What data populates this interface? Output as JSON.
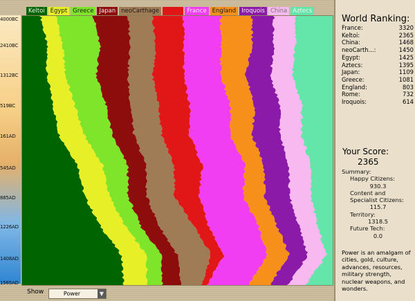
{
  "legend": [
    {
      "label": "Keltoi",
      "color": "#006400",
      "text": "#f2f2f2"
    },
    {
      "label": "Egypt",
      "color": "#e7ef26",
      "text": "#1b1b1b"
    },
    {
      "label": "Greece",
      "color": "#7ee52a",
      "text": "#1b1b1b"
    },
    {
      "label": "Japan",
      "color": "#8d0c0c",
      "text": "#eeeeee"
    },
    {
      "label": "neoCarthage",
      "color": "#a07c56",
      "text": "#1b1b1b"
    },
    {
      "label": "Rome",
      "color": "#e11717",
      "text": "#e11717"
    },
    {
      "label": "France",
      "color": "#f23ef2",
      "text": "#f2f2f2"
    },
    {
      "label": "England",
      "color": "#f7901b",
      "text": "#1b1b1b"
    },
    {
      "label": "Iroquois",
      "color": "#8b1aa8",
      "text": "#f2f2f2"
    },
    {
      "label": "China",
      "color": "#f8b8f0",
      "text": "#777777"
    },
    {
      "label": "Aztecs",
      "color": "#64e6aa",
      "text": "#f2f2f2"
    }
  ],
  "year_ticks": [
    "4000BC",
    "2410BC",
    "1312BC",
    "519BC",
    "161AD",
    "545AD",
    "885AD",
    "1226AD",
    "1408AD",
    "1565AD"
  ],
  "chart_data": {
    "type": "area",
    "x": [
      "4000BC",
      "2410BC",
      "1312BC",
      "519BC",
      "161AD",
      "545AD",
      "885AD",
      "1226AD",
      "1408AD",
      "1565AD"
    ],
    "stacked": true,
    "orientation": "vertical-time",
    "series_order": [
      "Keltoi",
      "Egypt",
      "Greece",
      "Japan",
      "neoCarthage",
      "Rome",
      "France",
      "England",
      "Iroquois",
      "China",
      "Aztecs"
    ],
    "series": [
      {
        "name": "Keltoi",
        "color": "#006400",
        "values": [
          6,
          8,
          8,
          10,
          12,
          18,
          20,
          25,
          32,
          34
        ]
      },
      {
        "name": "Egypt",
        "color": "#e7ef26",
        "values": [
          5,
          5,
          6,
          7,
          8,
          8,
          8,
          8,
          8,
          8
        ]
      },
      {
        "name": "Greece",
        "color": "#7ee52a",
        "values": [
          12,
          12,
          10,
          10,
          9,
          8,
          6,
          5,
          5,
          5
        ]
      },
      {
        "name": "Japan",
        "color": "#8d0c0c",
        "values": [
          11,
          10,
          10,
          8,
          7,
          6,
          6,
          6,
          5,
          6
        ]
      },
      {
        "name": "neoCarthage",
        "color": "#a07c56",
        "values": [
          8,
          8,
          8,
          9,
          9,
          9,
          9,
          11,
          11,
          7
        ]
      },
      {
        "name": "Rome",
        "color": "#e11717",
        "values": [
          10,
          9,
          10,
          10,
          9,
          9,
          8,
          5,
          4,
          2
        ]
      },
      {
        "name": "France",
        "color": "#f23ef2",
        "values": [
          12,
          12,
          12,
          13,
          13,
          14,
          14,
          16,
          14,
          14
        ]
      },
      {
        "name": "England",
        "color": "#f7901b",
        "values": [
          10,
          10,
          8,
          8,
          7,
          6,
          7,
          6,
          7,
          7
        ]
      },
      {
        "name": "Iroquois",
        "color": "#8b1aa8",
        "values": [
          7,
          7,
          8,
          8,
          9,
          8,
          8,
          7,
          6,
          6
        ]
      },
      {
        "name": "China",
        "color": "#f8b8f0",
        "values": [
          7,
          7,
          7,
          7,
          7,
          7,
          7,
          6,
          6,
          6
        ]
      },
      {
        "name": "Aztecs",
        "color": "#64e6aa",
        "values": [
          12,
          12,
          13,
          10,
          10,
          7,
          7,
          5,
          2,
          9
        ]
      }
    ]
  },
  "panel": {
    "ranking_title": "World Ranking:",
    "ranking": [
      {
        "name": "France:",
        "score": "3320"
      },
      {
        "name": "Keltoi:",
        "score": "2365"
      },
      {
        "name": "China:",
        "score": "1468"
      },
      {
        "name": "neoCarth...:",
        "score": "1450"
      },
      {
        "name": "Egypt:",
        "score": "1425"
      },
      {
        "name": "Aztecs:",
        "score": "1395"
      },
      {
        "name": "Japan:",
        "score": "1109"
      },
      {
        "name": "Greece:",
        "score": "1081"
      },
      {
        "name": "England:",
        "score": "803"
      },
      {
        "name": "Rome:",
        "score": "732"
      },
      {
        "name": "Iroquois:",
        "score": "614"
      }
    ],
    "score_label": "Your Score:",
    "score_value": "2365",
    "summary_label": "Summary:",
    "happy_label": "Happy Citizens:",
    "happy_value": "930.3",
    "content_label": "Content and",
    "specialist_label": "Specialist Citizens:",
    "content_value": "115.7",
    "territory_label": "Territory:",
    "territory_value": "1318.5",
    "future_label": "Future Tech:",
    "future_value": "0.0",
    "note": "Power is an amalgam of cities, gold, culture, advances, resources, military strength, nuclear weapons, and wonders."
  },
  "bottom": {
    "show_label": "Show",
    "show_value": "Power"
  }
}
